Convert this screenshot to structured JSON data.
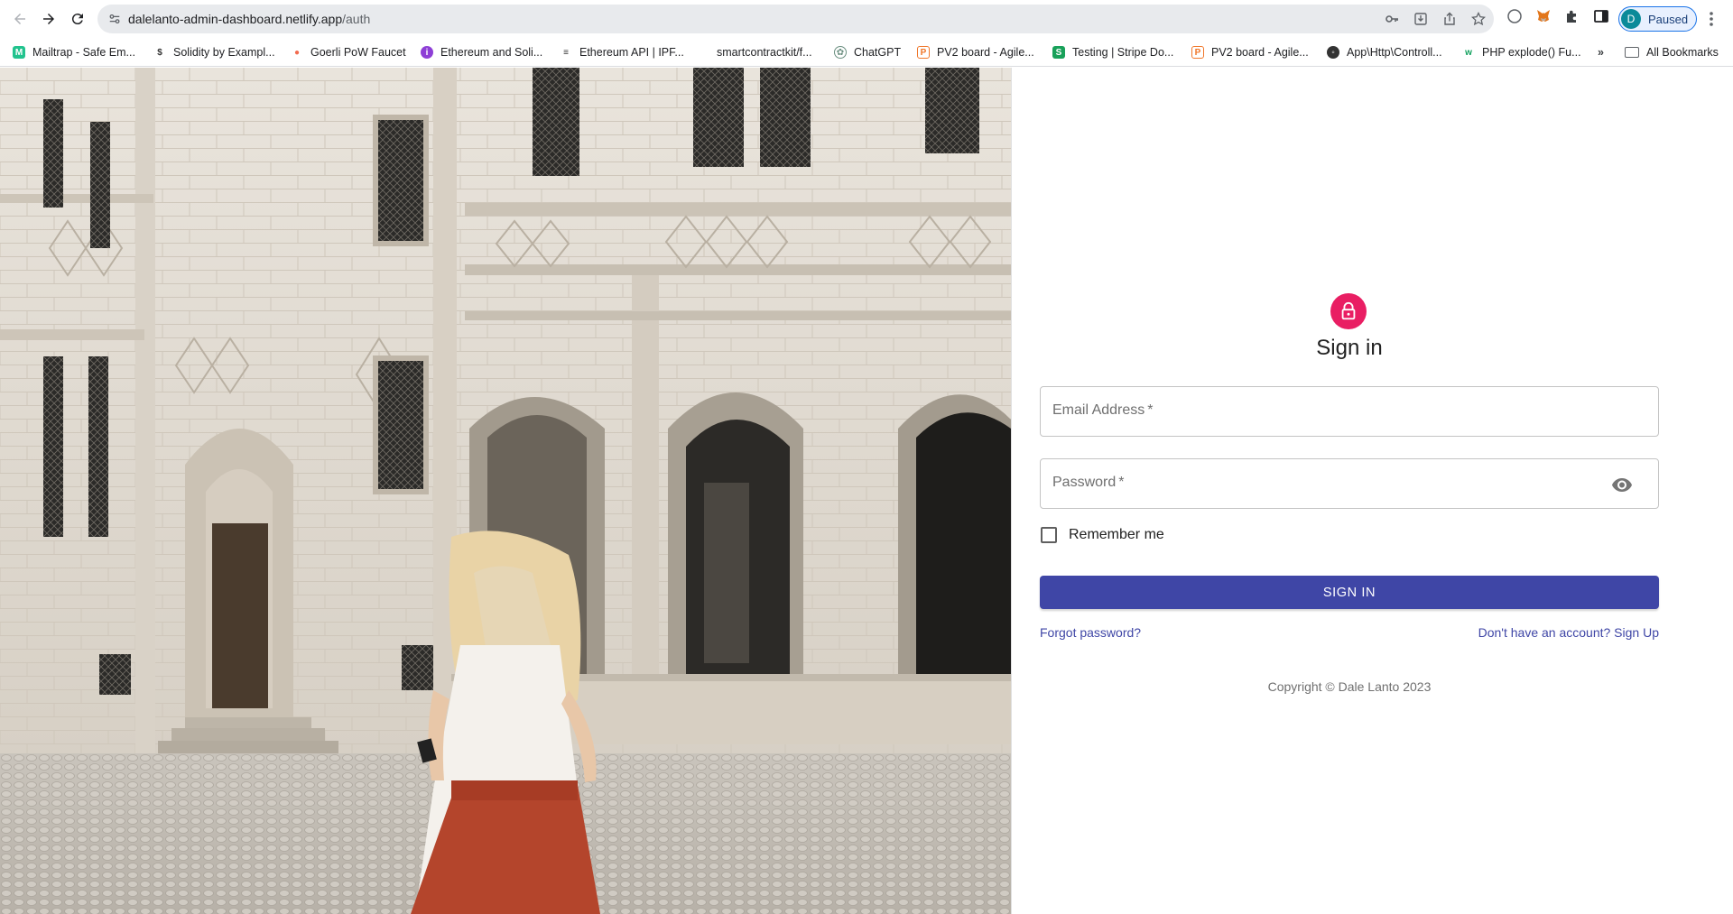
{
  "browser": {
    "url_host": "dalelanto-admin-dashboard.netlify.app",
    "url_path": "/auth",
    "profile_initial": "D",
    "profile_status": "Paused",
    "bookmarks": [
      {
        "label": "Mailtrap - Safe Em...",
        "icon": "mailtrap-icon",
        "color": "#22c38e"
      },
      {
        "label": "Solidity by Exampl...",
        "icon": "solidity-icon",
        "color": "#333333"
      },
      {
        "label": "Goerli PoW Faucet",
        "icon": "faucet-drop-icon",
        "color": "#f26b4f"
      },
      {
        "label": "Ethereum and Soli...",
        "icon": "ethereum-icon",
        "color": "#8e3fd6"
      },
      {
        "label": "Ethereum API | IPF...",
        "icon": "infura-icon",
        "color": "#333333"
      },
      {
        "label": "smartcontractkit/f...",
        "icon": "github-icon",
        "color": "#ffffff"
      },
      {
        "label": "ChatGPT",
        "icon": "chatgpt-icon",
        "color": "#6b8f80"
      },
      {
        "label": "PV2 board - Agile...",
        "icon": "jira-board-icon",
        "color": "#f0772a"
      },
      {
        "label": "Testing | Stripe Do...",
        "icon": "stripe-icon",
        "color": "#19a15a"
      },
      {
        "label": "PV2 board - Agile...",
        "icon": "jira-board-icon",
        "color": "#f0772a"
      },
      {
        "label": "App\\Http\\Controll...",
        "icon": "globe-icon",
        "color": "#333333"
      },
      {
        "label": "PHP explode() Fu...",
        "icon": "w3schools-icon",
        "color": "#10a05d"
      }
    ],
    "all_bookmarks_label": "All Bookmarks"
  },
  "signin": {
    "title": "Sign in",
    "email_label": "Email Address",
    "password_label": "Password",
    "required_mark": "*",
    "remember_label": "Remember me",
    "submit_label": "SIGN IN",
    "forgot_label": "Forgot password?",
    "signup_label": "Don't have an account? Sign Up",
    "copyright": "Copyright © Dale Lanto 2023",
    "accent": "#e91e63",
    "primary": "#3f46a6"
  }
}
